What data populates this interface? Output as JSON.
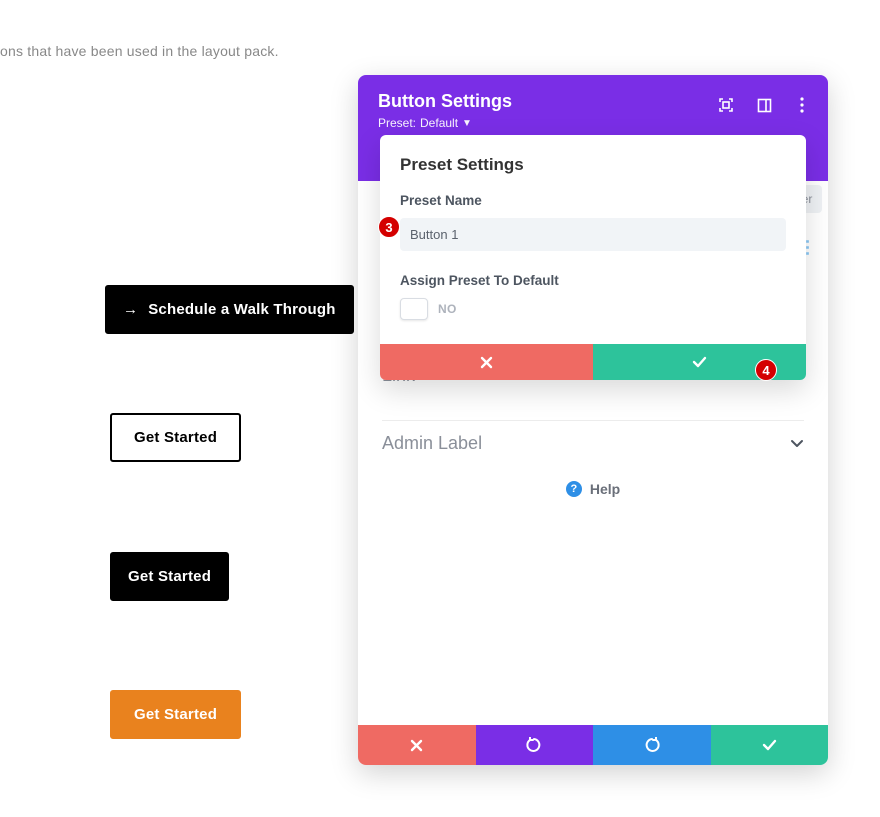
{
  "page": {
    "fragment": "ons that have been used in the layout pack."
  },
  "buttons": {
    "schedule": "Schedule a Walk Through",
    "get_started": "Get Started"
  },
  "modal": {
    "title": "Button Settings",
    "preset_prefix": "Preset:",
    "preset_name": "Default",
    "filter_hint": "er",
    "popover": {
      "title": "Preset Settings",
      "name_label": "Preset Name",
      "name_value": "Button 1",
      "assign_label": "Assign Preset To Default",
      "toggle_value": "NO"
    },
    "sections": {
      "link": "Link",
      "admin": "Admin Label"
    },
    "help": "Help"
  },
  "badges": {
    "three": "3",
    "four": "4"
  }
}
